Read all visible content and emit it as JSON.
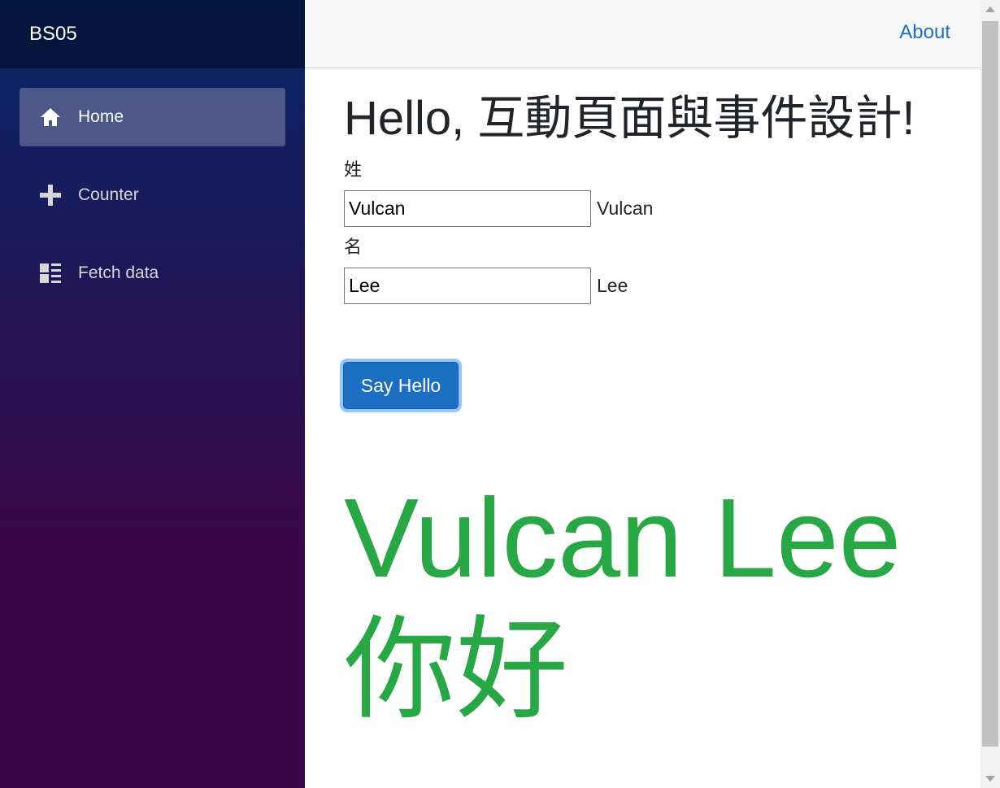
{
  "app": {
    "brand": "BS05"
  },
  "sidebar": {
    "items": [
      {
        "label": "Home",
        "icon": "home-icon",
        "active": true
      },
      {
        "label": "Counter",
        "icon": "plus-icon",
        "active": false
      },
      {
        "label": "Fetch data",
        "icon": "list-icon",
        "active": false
      }
    ]
  },
  "topbar": {
    "about_label": "About"
  },
  "main": {
    "title": "Hello, 互動頁面與事件設計!",
    "last_name_label": "姓",
    "last_name_value": "Vulcan",
    "last_name_echo": "Vulcan",
    "first_name_label": "名",
    "first_name_value": "Lee",
    "first_name_echo": "Lee",
    "button_label": "Say Hello",
    "greeting_line1": "Vulcan Lee",
    "greeting_line2": "你好"
  },
  "colors": {
    "sidebar_top": "#052767",
    "sidebar_bottom": "#3a0647",
    "accent": "#1b6ec2",
    "greeting": "#28a745"
  }
}
